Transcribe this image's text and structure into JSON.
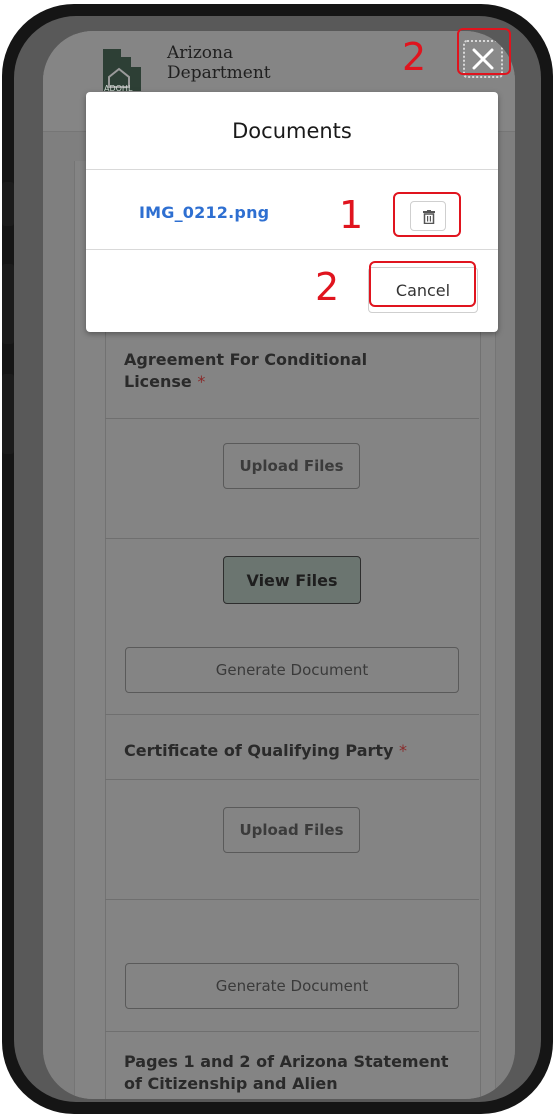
{
  "header": {
    "logo_line1": "Arizona",
    "logo_line2": "Department",
    "logo_mark": "ADOHL"
  },
  "modal": {
    "title": "Documents",
    "file_name": "IMG_0212.png",
    "delete_icon": "trash-icon",
    "cancel_label": "Cancel",
    "close_icon": "close-icon"
  },
  "sections": {
    "agreement_label": "Agreement For Conditional License",
    "agreement_upload": "Upload Files",
    "agreement_view": "View Files",
    "agreement_generate": "Generate Document",
    "certificate_label": "Certificate of Qualifying Party",
    "certificate_upload": "Upload Files",
    "certificate_generate": "Generate Document",
    "pages_label": "Pages 1 and 2 of Arizona Statement of Citizenship and Alien",
    "required_mark": "*"
  },
  "annotations": {
    "num_close": "2",
    "num_delete": "1",
    "num_cancel": "2",
    "color": "#e0141e"
  }
}
